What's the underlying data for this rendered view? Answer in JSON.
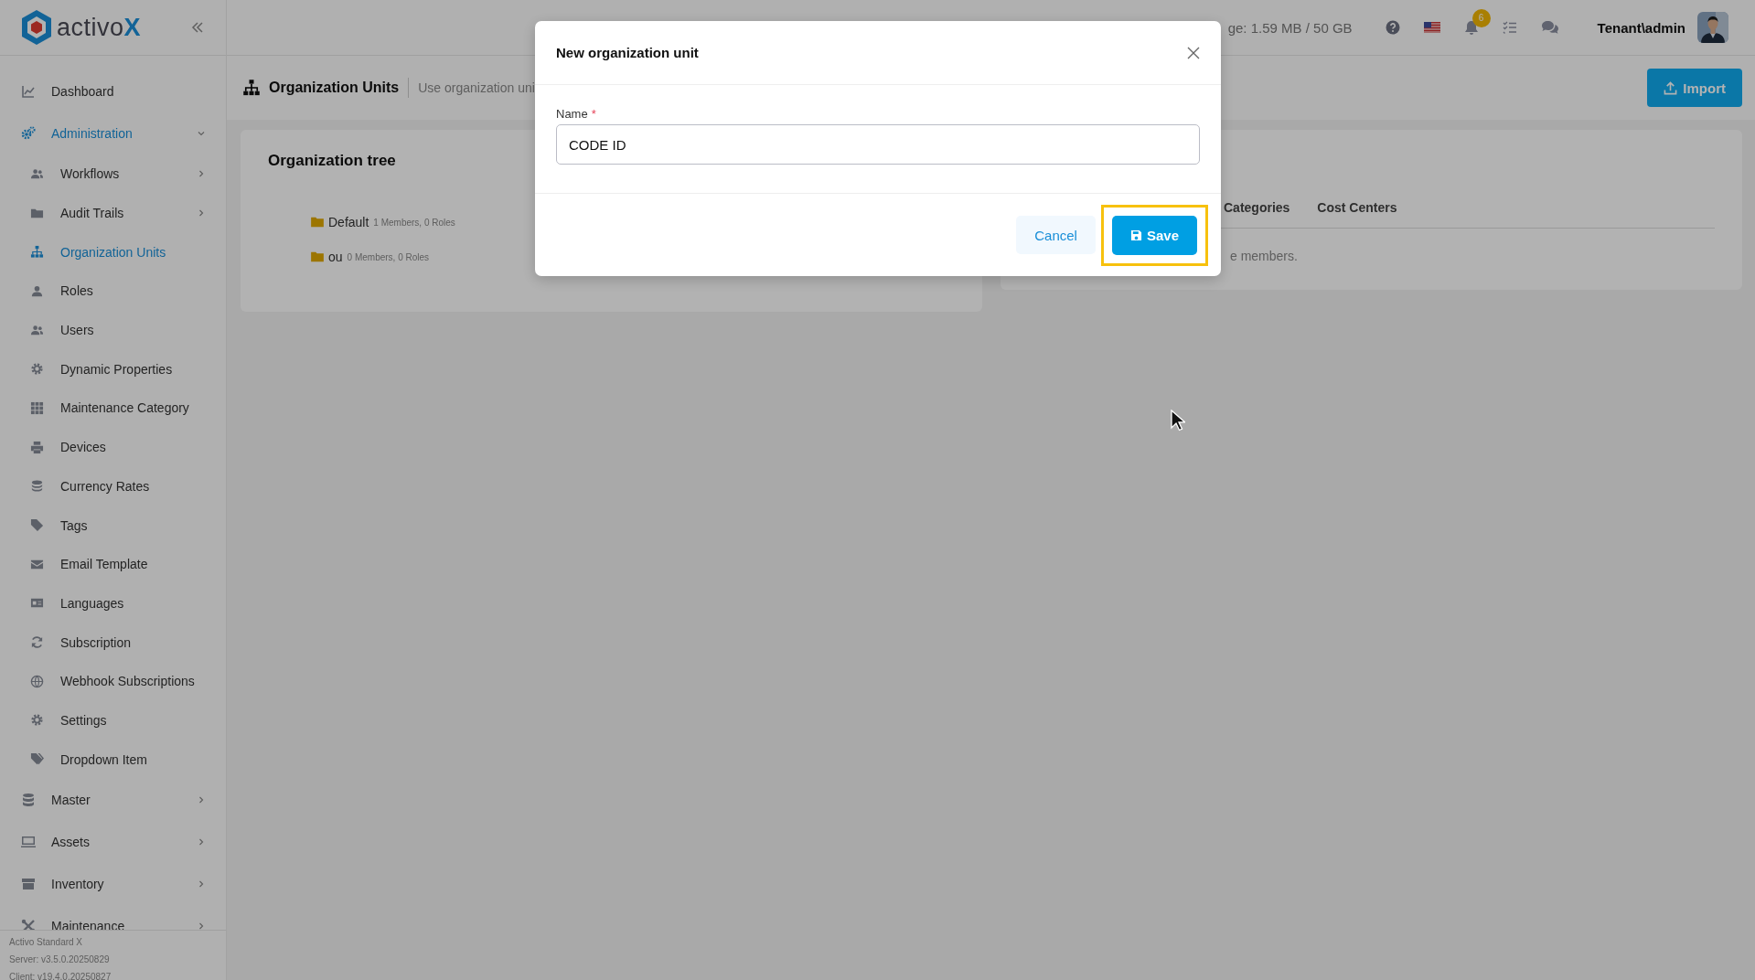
{
  "logo": {
    "text": "activo",
    "accent": "X"
  },
  "sidebar": {
    "items": [
      {
        "label": "Dashboard",
        "selected": false
      },
      {
        "label": "Administration",
        "selected": true,
        "expanded": true,
        "children": [
          {
            "label": "Workflows",
            "selected": false,
            "expanded": false
          },
          {
            "label": "Audit Trails",
            "selected": false,
            "expanded": false
          },
          {
            "label": "Organization Units",
            "selected": true
          },
          {
            "label": "Roles",
            "selected": false
          },
          {
            "label": "Users",
            "selected": false
          },
          {
            "label": "Dynamic Properties",
            "selected": false
          },
          {
            "label": "Maintenance Category",
            "selected": false
          },
          {
            "label": "Devices",
            "selected": false
          },
          {
            "label": "Currency Rates",
            "selected": false
          },
          {
            "label": "Tags",
            "selected": false
          },
          {
            "label": "Email Template",
            "selected": false
          },
          {
            "label": "Languages",
            "selected": false
          },
          {
            "label": "Subscription",
            "selected": false
          },
          {
            "label": "Webhook Subscriptions",
            "selected": false
          },
          {
            "label": "Settings",
            "selected": false
          },
          {
            "label": "Dropdown Item",
            "selected": false
          }
        ]
      },
      {
        "label": "Master",
        "selected": false,
        "expanded": false
      },
      {
        "label": "Assets",
        "selected": false,
        "expanded": false
      },
      {
        "label": "Inventory",
        "selected": false,
        "expanded": false
      },
      {
        "label": "Maintenance",
        "selected": false,
        "expanded": false
      }
    ],
    "footer": [
      "Activo Standard X",
      "Server: v3.5.0.20250829",
      "Client: v19.4.0.20250827"
    ]
  },
  "header": {
    "storage": "ge: 1.59 MB / 50 GB",
    "notification_count": "6",
    "user": "Tenant\\admin"
  },
  "page": {
    "title": "Organization Units",
    "subtitle": "Use organization uni",
    "import_button": "Import"
  },
  "organization_tree": {
    "title": "Organization tree",
    "nodes": [
      {
        "name": "Default",
        "info": "1 Members, 0 Roles"
      },
      {
        "name": "ou",
        "info": "0 Members, 0 Roles"
      }
    ]
  },
  "details": {
    "tabs": [
      {
        "label": "Categories",
        "selected": false
      },
      {
        "label": "Cost Centers",
        "selected": false
      }
    ],
    "message": "e members."
  },
  "dialog": {
    "title": "New organization unit",
    "field": {
      "label": "Name",
      "required_mark": "*",
      "value": "CODE ID"
    },
    "buttons": {
      "cancel": "Cancel",
      "save": "Save"
    },
    "save_highlighted": true
  }
}
